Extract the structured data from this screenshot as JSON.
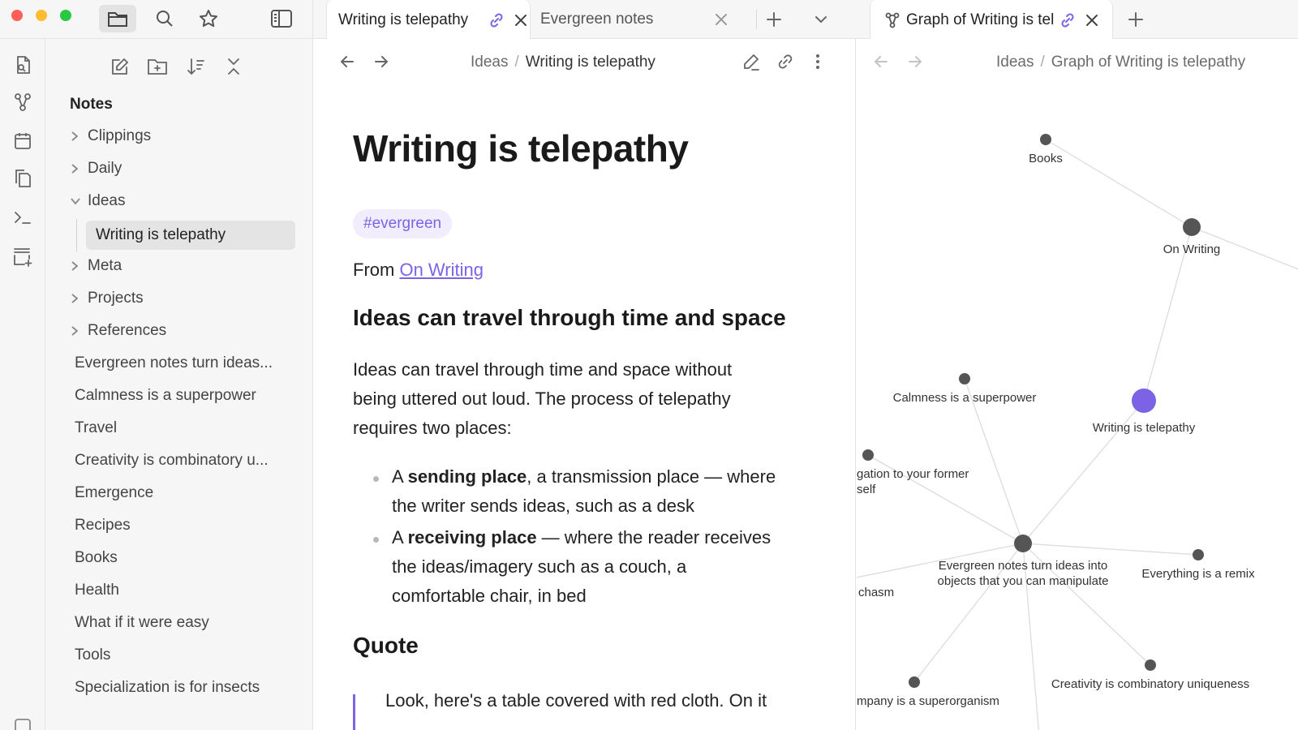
{
  "sidebar_toolbar": {
    "icons": [
      "folder-icon",
      "search-icon",
      "star-icon",
      "sidebar-toggle-icon"
    ]
  },
  "tabs": {
    "main": [
      {
        "title": "Writing is telepathy",
        "active": true,
        "linked": true
      },
      {
        "title": "Evergreen notes",
        "active": false,
        "linked": false
      }
    ],
    "graph": [
      {
        "title": "Graph of Writing is telepathy",
        "active": true,
        "linked": true
      }
    ]
  },
  "ribbon": {
    "icons": [
      "open-quick-switcher-icon",
      "graph-view-icon",
      "daily-note-icon",
      "templates-icon",
      "command-palette-icon",
      "new-canvas-icon"
    ]
  },
  "sidebar": {
    "actions": [
      "new-note-icon",
      "new-folder-icon",
      "sort-icon",
      "collapse-all-icon"
    ],
    "vault_name": "Notes",
    "folders": [
      {
        "name": "Clippings",
        "expanded": false
      },
      {
        "name": "Daily",
        "expanded": false
      },
      {
        "name": "Ideas",
        "expanded": true
      },
      {
        "name": "Meta",
        "expanded": false
      },
      {
        "name": "Projects",
        "expanded": false
      },
      {
        "name": "References",
        "expanded": false
      }
    ],
    "selected_note": "Writing is telepathy",
    "files": [
      "Evergreen notes turn ideas...",
      "Calmness is a superpower",
      "Travel",
      "Creativity is combinatory u...",
      "Emergence",
      "Recipes",
      "Books",
      "Health",
      "What if it were easy",
      "Tools",
      "Specialization is for insects"
    ]
  },
  "editor": {
    "breadcrumb": {
      "folder": "Ideas",
      "note": "Writing is telepathy"
    },
    "title": "Writing is telepathy",
    "tag": "#evergreen",
    "from_prefix": "From",
    "from_link": "On Writing",
    "heading1": "Ideas can travel through time and space",
    "para_lines": [
      "Ideas can travel through time and space without",
      "being uttered out loud. The process of telepathy",
      "requires two places:"
    ],
    "bullet1": {
      "prefix": "A ",
      "bold": "sending place",
      "line1_rest": ", a transmission place — where",
      "line2": "the writer sends ideas, such as a desk"
    },
    "bullet2": {
      "prefix": "A ",
      "bold": "receiving place",
      "line1_rest": " — where the reader receives",
      "line2": "the ideas/imagery such as a couch, a",
      "line3": "comfortable chair, in bed"
    },
    "heading2": "Quote",
    "quote": "Look, here's a table covered with red cloth. On it"
  },
  "graph": {
    "breadcrumb": {
      "folder": "Ideas",
      "note": "Graph of Writing is telepathy"
    },
    "accent": "#7c63e6",
    "node_color": "#555555",
    "nodes": [
      {
        "id": "books",
        "label_lines": [
          "Books"
        ],
        "current": false
      },
      {
        "id": "on-writing",
        "label_lines": [
          "On Writing"
        ],
        "current": false
      },
      {
        "id": "writing-telepathy",
        "label_lines": [
          "Writing is telepathy"
        ],
        "current": true
      },
      {
        "id": "calmness",
        "label_lines": [
          "Calmness is a superpower"
        ],
        "current": false
      },
      {
        "id": "obligation",
        "label_lines": [
          "gation to your former",
          "self"
        ],
        "current": false
      },
      {
        "id": "evergreen",
        "label_lines": [
          "Evergreen notes turn ideas into",
          "objects that you can manipulate"
        ],
        "current": false
      },
      {
        "id": "remix",
        "label_lines": [
          "Everything is a remix"
        ],
        "current": false
      },
      {
        "id": "chasm",
        "label_lines": [
          "chasm"
        ],
        "current": false
      },
      {
        "id": "superorganism",
        "label_lines": [
          "mpany is a superorganism"
        ],
        "current": false
      },
      {
        "id": "creativity",
        "label_lines": [
          "Creativity is combinatory uniqueness"
        ],
        "current": false
      }
    ]
  },
  "colors": {
    "accent": "#7c63e6",
    "tag_bg": "#f1edfd",
    "chrome_bg": "#f6f6f6",
    "selected_bg": "#e4e4e4"
  }
}
